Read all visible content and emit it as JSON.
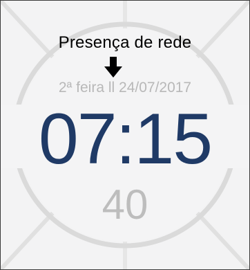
{
  "annotation": {
    "text": "Presença de rede"
  },
  "clock": {
    "date": "2ª feira ll 24/07/2017",
    "time": "07:15",
    "seconds": "40"
  },
  "icons": {
    "arrow": "arrow-down-icon"
  },
  "colors": {
    "background": "#f3f3f4",
    "ring": "#d8d8d8",
    "time": "#1f3a66",
    "date": "#b8b8b8",
    "seconds": "#bdbdbd"
  }
}
